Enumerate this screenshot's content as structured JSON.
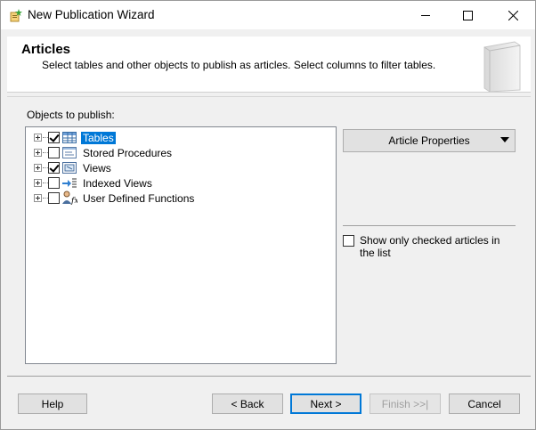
{
  "window": {
    "title": "New Publication Wizard",
    "controls": {
      "minimize": "minimize-icon",
      "maximize": "maximize-icon",
      "close": "close-icon"
    }
  },
  "header": {
    "title": "Articles",
    "description": "Select tables and other objects to publish as articles. Select columns to filter tables."
  },
  "objects_label": "Objects to publish:",
  "tree": {
    "items": [
      {
        "label": "Tables",
        "checked": true,
        "selected": true,
        "icon": "table-icon"
      },
      {
        "label": "Stored Procedures",
        "checked": false,
        "selected": false,
        "icon": "stored-procedure-icon"
      },
      {
        "label": "Views",
        "checked": true,
        "selected": false,
        "icon": "view-icon"
      },
      {
        "label": "Indexed Views",
        "checked": false,
        "selected": false,
        "icon": "indexed-view-icon"
      },
      {
        "label": "User Defined Functions",
        "checked": false,
        "selected": false,
        "icon": "function-icon"
      }
    ]
  },
  "right_panel": {
    "article_properties_label": "Article Properties",
    "show_checked_label": "Show only checked articles in the list",
    "show_checked": false
  },
  "buttons": {
    "help": "Help",
    "back": "< Back",
    "next": "Next >",
    "finish": "Finish >>|",
    "cancel": "Cancel"
  },
  "colors": {
    "selection": "#0078d7",
    "button_face": "#e1e1e1",
    "dialog_bg": "#f0f0f0"
  }
}
